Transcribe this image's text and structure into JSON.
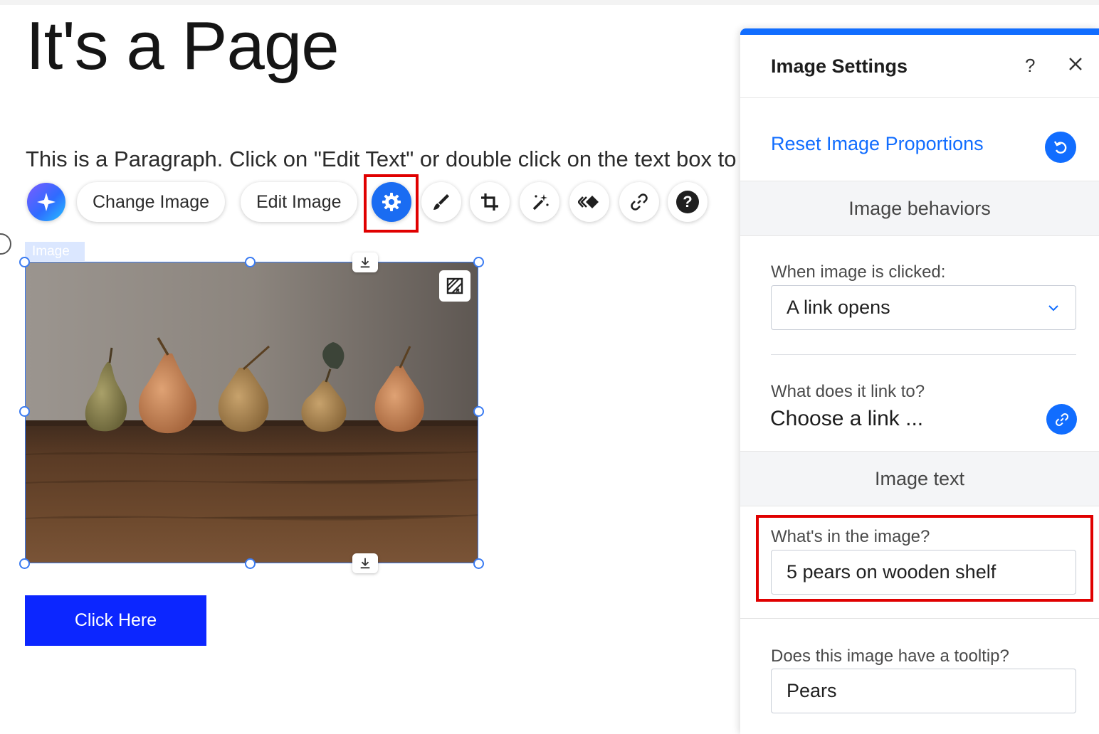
{
  "page": {
    "title": "It's a Page",
    "paragraph": "This is a Paragraph. Click on \"Edit Text\" or double click on the text box to start editing the content and make sure to add any relevant details or information that you want to share with your visitors.",
    "button_label": "Click Here",
    "image_tag": "Image",
    "image_description": "5 pears on wooden shelf"
  },
  "toolbar": {
    "change_image": "Change Image",
    "edit_image": "Edit Image",
    "help_glyph": "?",
    "icons": [
      "ai-sparkle-icon",
      "gear-icon",
      "brush-icon",
      "crop-icon",
      "magic-wand-icon",
      "animation-icon",
      "link-icon",
      "help-icon"
    ]
  },
  "panel": {
    "title": "Image Settings",
    "help": "?",
    "close": "×",
    "reset_link": "Reset Image Proportions",
    "behaviors_header": "Image behaviors",
    "click_label": "When image is clicked:",
    "click_value": "A link opens",
    "link_label": "What does it link to?",
    "link_value": "Choose a link ...",
    "text_header": "Image text",
    "alt_label": "What's in the image?",
    "alt_value": "5 pears on wooden shelf",
    "tooltip_label": "Does this image have a tooltip?",
    "tooltip_value": "Pears"
  },
  "colors": {
    "accent_blue": "#116dff",
    "highlight_red": "#e00000",
    "cta_blue": "#0c26ff"
  }
}
